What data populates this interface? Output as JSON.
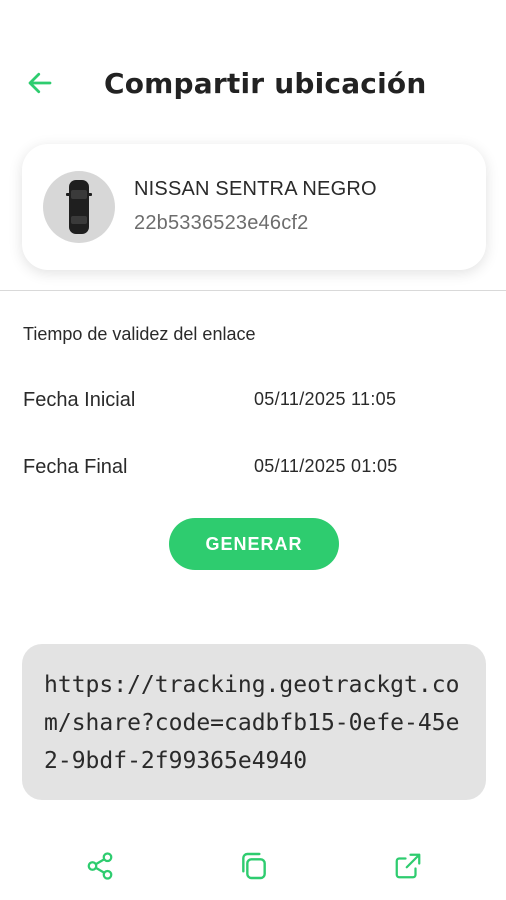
{
  "header": {
    "title": "Compartir ubicación",
    "back_icon": "arrow-left-icon"
  },
  "vehicle": {
    "name": "NISSAN SENTRA NEGRO",
    "code": "22b5336523e46cf2",
    "avatar_icon": "car-top-view-icon"
  },
  "validity": {
    "section_label": "Tiempo de validez del enlace",
    "start_label": "Fecha Inicial",
    "start_value": "05/11/2025 11:05",
    "end_label": "Fecha Final",
    "end_value": "05/11/2025 01:05"
  },
  "generate": {
    "label": "GENERAR"
  },
  "link": {
    "url": "https://tracking.geotrackgt.com/share?code=cadbfb15-0efe-45e2-9bdf-2f99365e4940"
  },
  "actions": [
    {
      "name": "share",
      "icon": "share-icon"
    },
    {
      "name": "copy",
      "icon": "copy-icon"
    },
    {
      "name": "open",
      "icon": "open-external-icon"
    }
  ],
  "colors": {
    "accent": "#2ecc6f",
    "url_box_bg": "#e3e3e3",
    "avatar_bg": "#d7d7d7"
  }
}
